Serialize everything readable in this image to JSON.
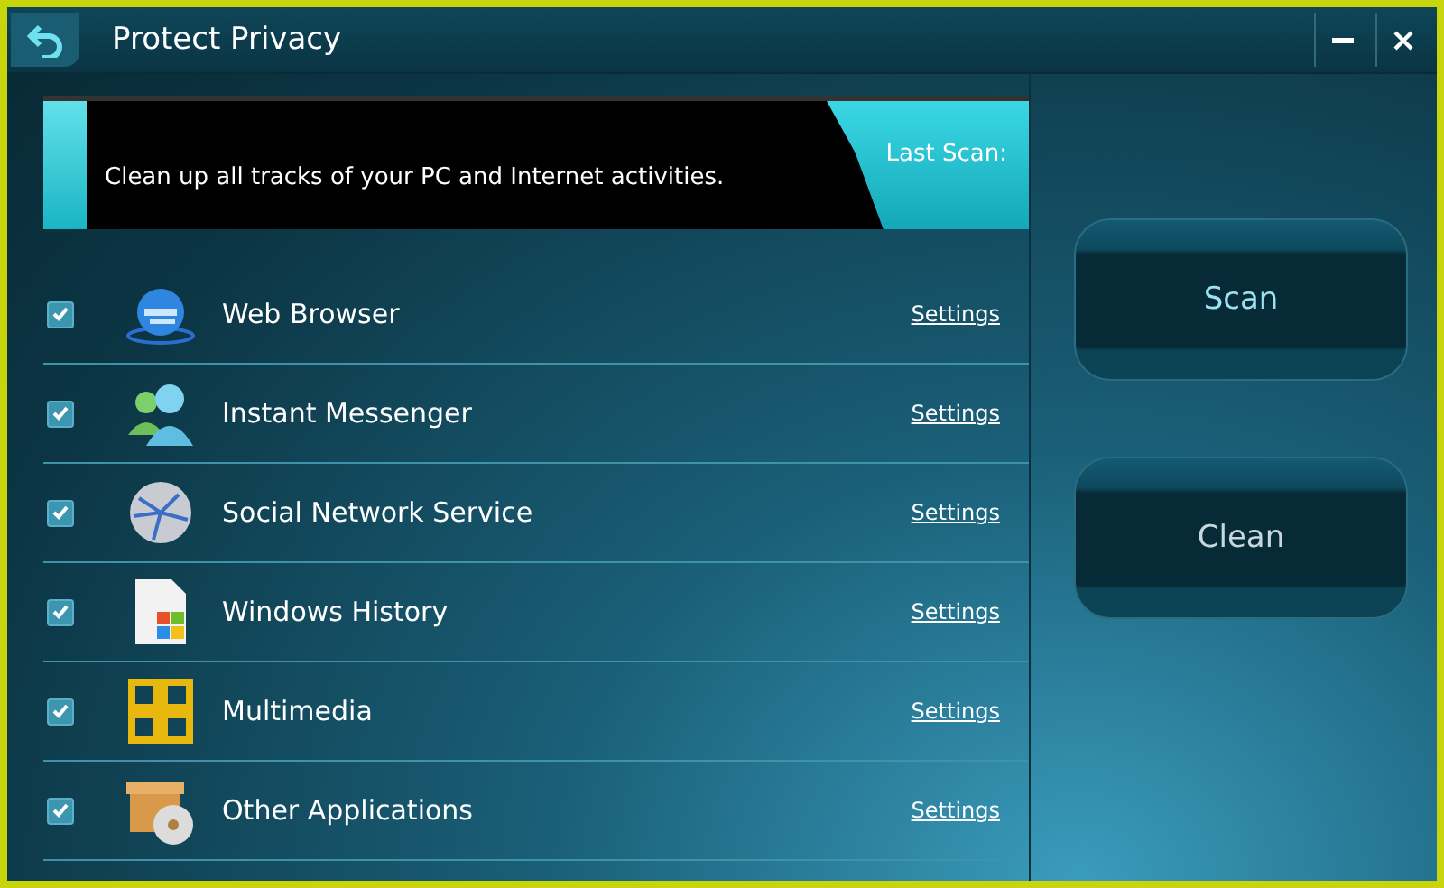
{
  "window": {
    "title": "Protect Privacy"
  },
  "banner": {
    "text": "Clean up all tracks of your PC and Internet activities.",
    "last_scan": "Last Scan:"
  },
  "items": [
    {
      "kind": "browser",
      "label": "Web Browser",
      "checked": true,
      "link": "Settings"
    },
    {
      "kind": "messenger",
      "label": "Instant Messenger",
      "checked": true,
      "link": "Settings"
    },
    {
      "kind": "globe",
      "label": "Social Network Service",
      "checked": true,
      "link": "Settings"
    },
    {
      "kind": "history",
      "label": "Windows History",
      "checked": true,
      "link": "Settings"
    },
    {
      "kind": "media",
      "label": "Multimedia",
      "checked": true,
      "link": "Settings"
    },
    {
      "kind": "apps",
      "label": "Other Applications",
      "checked": true,
      "link": "Settings"
    }
  ],
  "buttons": [
    "Scan",
    "Clean"
  ]
}
